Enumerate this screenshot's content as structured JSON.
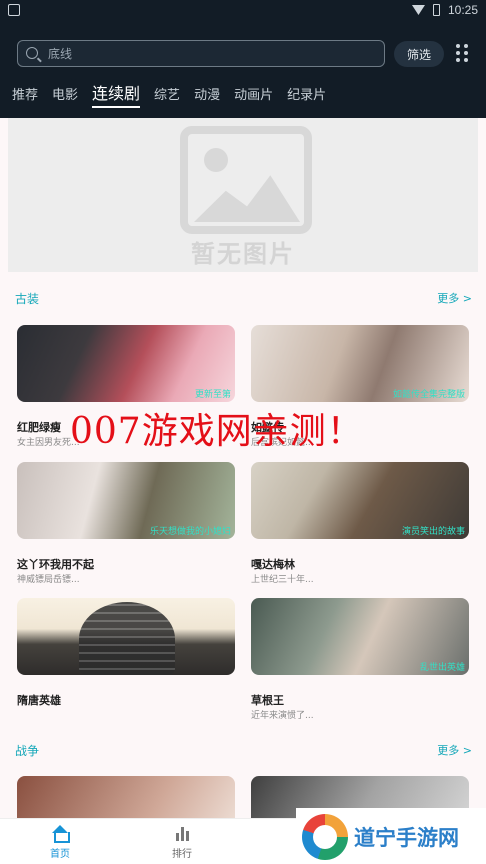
{
  "status_bar": {
    "time": "10:25"
  },
  "header": {
    "search_placeholder": "底线",
    "filter_label": "筛选",
    "tabs": [
      {
        "label": "推荐",
        "active": false
      },
      {
        "label": "电影",
        "active": false
      },
      {
        "label": "连续剧",
        "active": true
      },
      {
        "label": "综艺",
        "active": false
      },
      {
        "label": "动漫",
        "active": false
      },
      {
        "label": "动画片",
        "active": false
      },
      {
        "label": "纪录片",
        "active": false
      }
    ]
  },
  "banner": {
    "placeholder_text": "暂无图片"
  },
  "sections": [
    {
      "title": "古装",
      "more": "更多 >",
      "items": [
        {
          "title": "红肥绿瘦",
          "desc": "女主因男友死...",
          "badge": "更新至第"
        },
        {
          "title": "如懿传",
          "desc": "后宫嫔妃如懿...",
          "badge": "如懿传全集完整版"
        },
        {
          "title": "这丫环我用不起",
          "desc": "神威镖局岳镖...",
          "badge": "乐天想做我的小媳妇"
        },
        {
          "title": "嘎达梅林",
          "desc": "上世纪三十年...",
          "badge": "演员笑出的故事"
        },
        {
          "title": "隋唐英雄",
          "desc": "",
          "badge": ""
        },
        {
          "title": "草根王",
          "desc": "近年来演惯了...",
          "badge": "乱世出英雄"
        }
      ]
    },
    {
      "title": "战争",
      "more": "更多 >"
    }
  ],
  "overlay": {
    "watermark": "007游戏网亲测！",
    "brand": "道宁手游网"
  },
  "bottom_nav": [
    {
      "label": "首页",
      "active": true,
      "icon": "home-icon"
    },
    {
      "label": "排行",
      "active": false,
      "icon": "rank-icon"
    }
  ],
  "colors": {
    "accent": "#14a7b8",
    "header_bg": "#121c26",
    "nav_active": "#1793d6"
  }
}
